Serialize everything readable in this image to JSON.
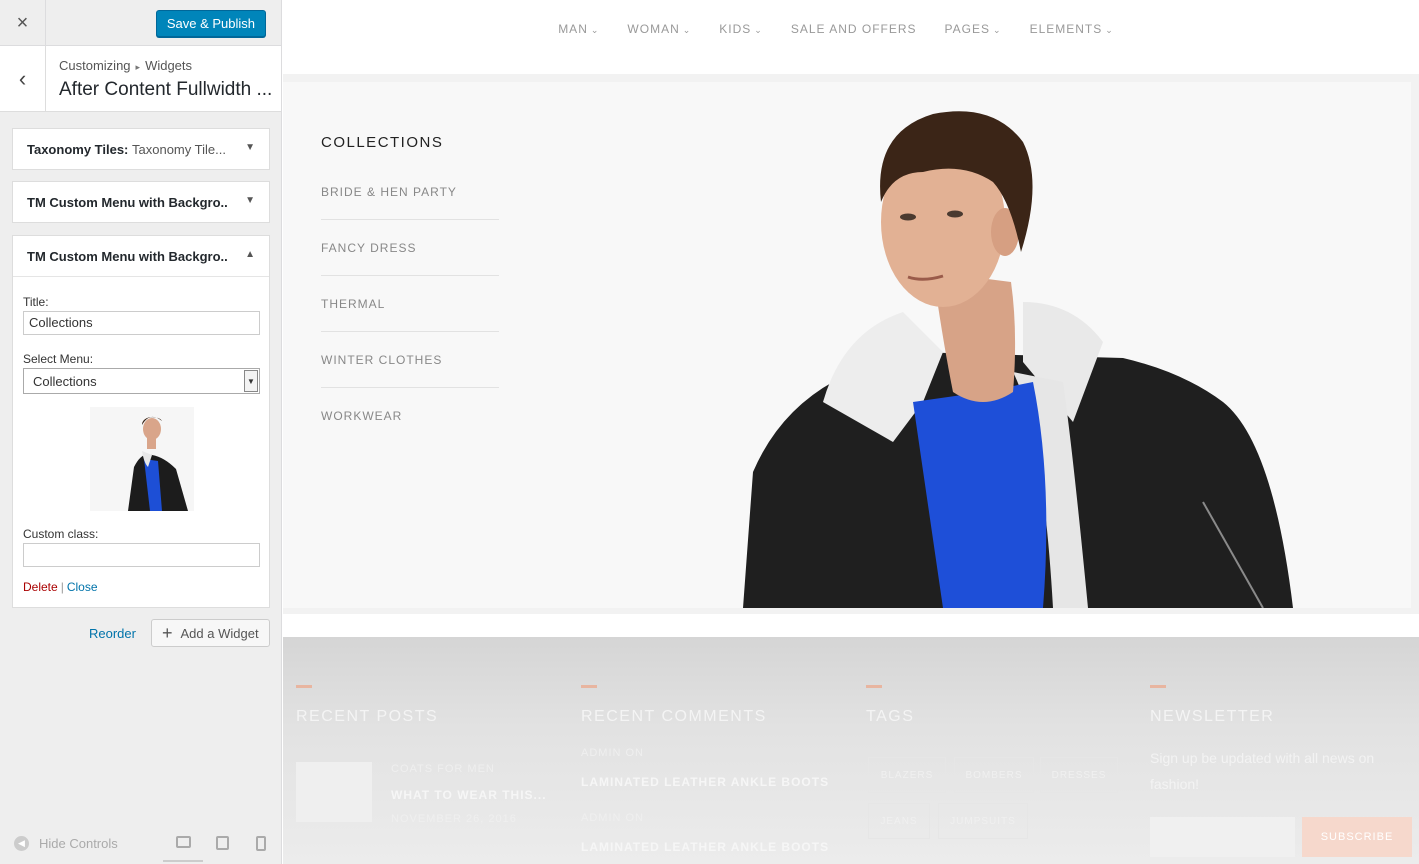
{
  "sidebar": {
    "close_icon": "×",
    "publish_label": "Save & Publish",
    "back_icon": "‹",
    "breadcrumb": {
      "root": "Customizing",
      "sep": "▸",
      "current": "Widgets"
    },
    "section_title": "After Content Fullwidth ...",
    "widgets": [
      {
        "name": "Taxonomy Tiles:",
        "sub": "Taxonomy Tile...",
        "state": "collapsed"
      },
      {
        "name": "TM Custom Menu with Backgro...",
        "sub": "",
        "state": "collapsed"
      },
      {
        "name": "TM Custom Menu with Backgro...",
        "sub": "",
        "state": "expanded"
      }
    ],
    "form": {
      "title_label": "Title:",
      "title_value": "Collections",
      "menu_label": "Select Menu:",
      "menu_value": "Collections",
      "class_label": "Custom class:",
      "class_value": "",
      "delete_label": "Delete",
      "sep": "|",
      "close_label": "Close"
    },
    "reorder_label": "Reorder",
    "add_widget_label": "Add a Widget",
    "hide_controls_label": "Hide Controls"
  },
  "preview": {
    "nav": [
      "MAN",
      "WOMAN",
      "KIDS",
      "SALE AND OFFERS",
      "PAGES",
      "ELEMENTS"
    ],
    "collections_title": "COLLECTIONS",
    "collections": [
      "BRIDE & HEN PARTY",
      "FANCY DRESS",
      "THERMAL",
      "WINTER CLOTHES",
      "WORKWEAR"
    ],
    "footer": {
      "recent_posts": "RECENT POSTS",
      "recent_comments": "RECENT COMMENTS",
      "tags": "TAGS",
      "newsletter": "NEWSLETTER",
      "post_category": "COATS FOR MEN",
      "post_title": "WHAT TO WEAR THIS...",
      "post_date": "NOVEMBER 26, 2016",
      "comment_meta": "ADMIN ON",
      "comment_title": "LAMINATED LEATHER ANKLE BOOTS",
      "tag_list": [
        "BLAZERS",
        "BOMBERS",
        "DRESSES",
        "JEANS",
        "JUMPSUITS"
      ],
      "newsletter_text": "Sign up be updated with all news on fashion!",
      "subscribe": "SUBSCRIBE"
    }
  }
}
